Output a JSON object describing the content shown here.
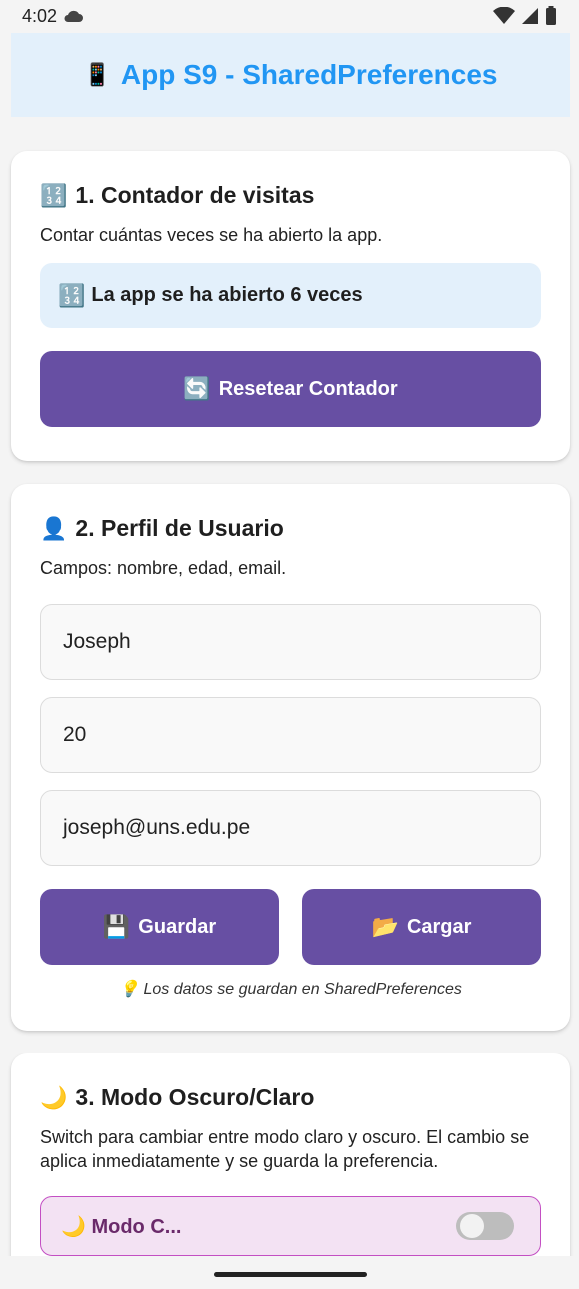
{
  "status": {
    "time": "4:02",
    "cloud_icon": "cloud-icon",
    "wifi_icon": "wifi-icon",
    "signal_icon": "signal-icon",
    "battery_icon": "battery-icon"
  },
  "header": {
    "icon": "📱",
    "title": "App S9 - SharedPreferences"
  },
  "counter_card": {
    "icon": "🔢",
    "title": "1. Contador de visitas",
    "description": "Contar cuántas veces se ha abierto la app.",
    "info_icon": "🔢",
    "info_text": "La app se ha abierto 6 veces",
    "reset_icon": "🔄",
    "reset_label": "Resetear Contador"
  },
  "profile_card": {
    "icon": "👤",
    "title": "2. Perfil de Usuario",
    "description": "Campos: nombre, edad, email.",
    "name_value": "Joseph",
    "age_value": "20",
    "email_value": "joseph@uns.edu.pe",
    "save_icon": "💾",
    "save_label": "Guardar",
    "load_icon": "📂",
    "load_label": "Cargar",
    "note_icon": "💡",
    "note_text": "Los datos se guardan en SharedPreferences"
  },
  "mode_card": {
    "icon": "🌙",
    "title": "3. Modo Oscuro/Claro",
    "description": "Switch para cambiar entre modo claro y oscuro. El cambio se aplica inmediatamente y se guarda la preferencia.",
    "mode_label": "🌙 Modo C...",
    "switch_on": false
  },
  "colors": {
    "accent": "#2196f3",
    "button": "#674fa3",
    "info_bg": "#e3f0fb",
    "mode_bg": "#f3e2f3",
    "mode_border": "#c34fc3"
  }
}
